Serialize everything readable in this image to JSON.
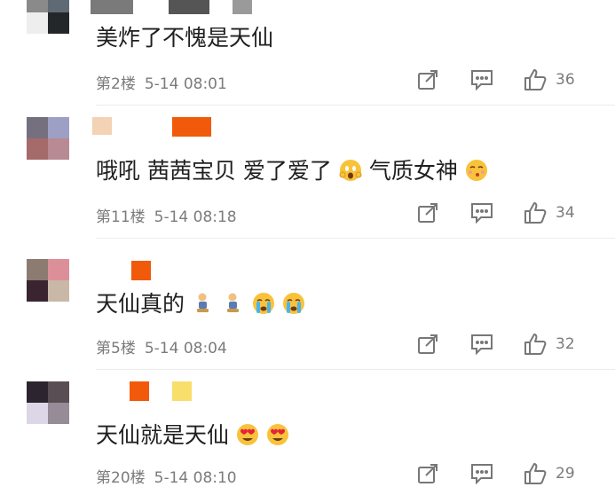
{
  "comments": [
    {
      "text": "美炸了不愧是天仙",
      "floor": "第2楼",
      "time": "5-14 08:01",
      "likes": "36",
      "avatar_colors": [
        "#8a8a8a",
        "#5f6a74",
        "#eeeeee",
        "#24272a"
      ],
      "name_colors": [
        "#7a7a7a",
        "#555555",
        "#9a9a9a"
      ]
    },
    {
      "text_a": "哦吼 茜茜宝贝 爱了爱了",
      "text_b": "气质女神",
      "floor": "第11楼",
      "time": "5-14 08:18",
      "likes": "34",
      "avatar_colors": [
        "#757080",
        "#9da0c4",
        "#a56a6a",
        "#b88a93"
      ],
      "name_colors": [
        "#f3d2b5",
        "#f05a0a"
      ]
    },
    {
      "text": "天仙真的",
      "floor": "第5楼",
      "time": "5-14 08:04",
      "likes": "32",
      "avatar_colors": [
        "#8b7b70",
        "#dd8f99",
        "#3a2430",
        "#c9b8a8"
      ],
      "name_colors": [
        "#f05a0a"
      ]
    },
    {
      "text": "天仙就是天仙",
      "floor": "第20楼",
      "time": "5-14 08:10",
      "likes": "29",
      "avatar_colors": [
        "#2c2530",
        "#5a4e55",
        "#dcd6e6",
        "#958c98"
      ],
      "name_colors": [
        "#f05a0a",
        "#f8de6a"
      ]
    }
  ],
  "icons": [
    "share-icon",
    "reply-icon",
    "like-icon"
  ]
}
